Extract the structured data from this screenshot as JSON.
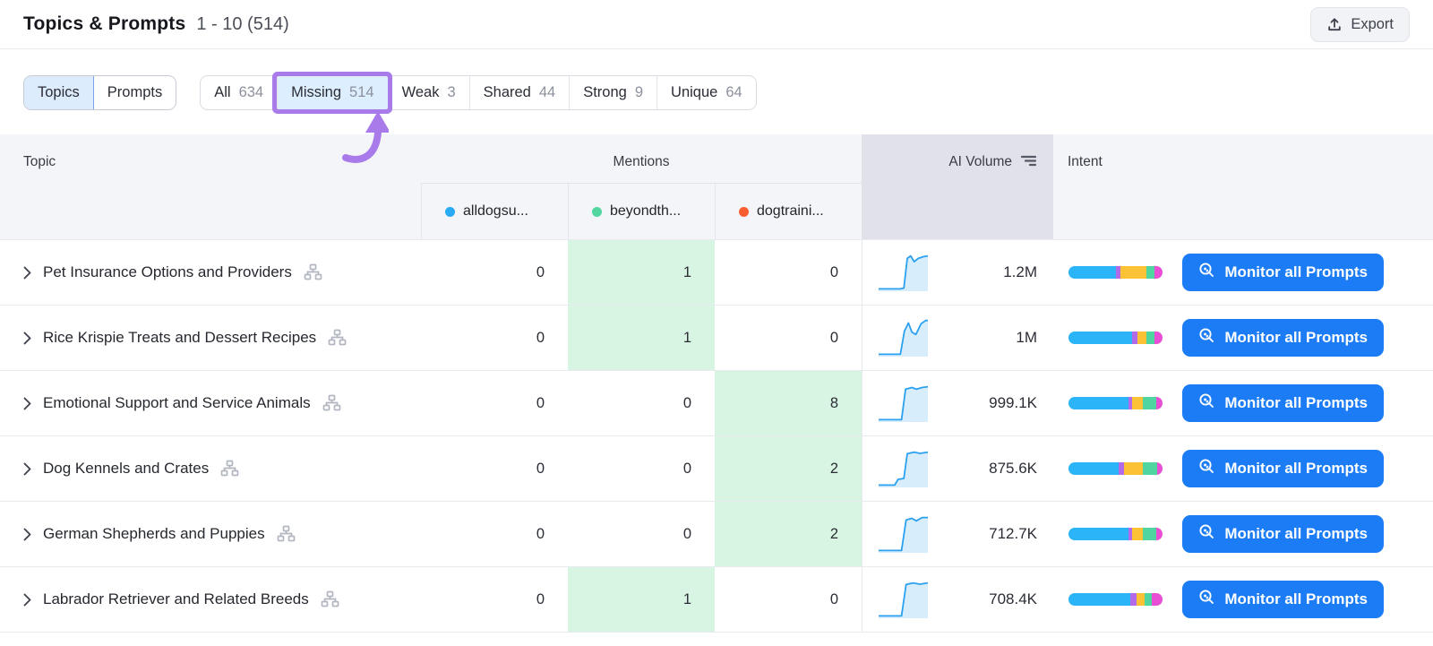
{
  "header": {
    "title": "Topics & Prompts",
    "range": "1 - 10 (514)",
    "export_label": "Export"
  },
  "toggle": [
    {
      "label": "Topics",
      "selected": true
    },
    {
      "label": "Prompts",
      "selected": false
    }
  ],
  "filters": [
    {
      "label": "All",
      "count": "634",
      "selected": false,
      "annotated": false
    },
    {
      "label": "Missing",
      "count": "514",
      "selected": true,
      "annotated": true
    },
    {
      "label": "Weak",
      "count": "3",
      "selected": false,
      "annotated": false
    },
    {
      "label": "Shared",
      "count": "44",
      "selected": false,
      "annotated": false
    },
    {
      "label": "Strong",
      "count": "9",
      "selected": false,
      "annotated": false
    },
    {
      "label": "Unique",
      "count": "64",
      "selected": false,
      "annotated": false
    }
  ],
  "table": {
    "columns": {
      "topic": "Topic",
      "mentions": "Mentions",
      "ai_volume": "AI Volume",
      "intent": "Intent"
    },
    "competitors": [
      {
        "name": "alldogsu...",
        "color": "#29aaf4"
      },
      {
        "name": "beyondth...",
        "color": "#52d6a0"
      },
      {
        "name": "dogtraini...",
        "color": "#fb5e31"
      }
    ],
    "button_label": "Monitor all Prompts",
    "rows": [
      {
        "topic": "Pet Insurance Options and Providers",
        "mentions": [
          "0",
          "1",
          "0"
        ],
        "highlight": 1,
        "ai_volume": "1.2M",
        "spark": [
          [
            0,
            90
          ],
          [
            38,
            90
          ],
          [
            44,
            88
          ],
          [
            50,
            16
          ],
          [
            56,
            10
          ],
          [
            62,
            24
          ],
          [
            69,
            16
          ],
          [
            78,
            12
          ],
          [
            86,
            10
          ]
        ],
        "intent": [
          50,
          5,
          28,
          8,
          9
        ]
      },
      {
        "topic": "Rice Krispie Treats and Dessert Recipes",
        "mentions": [
          "0",
          "1",
          "0"
        ],
        "highlight": 1,
        "ai_volume": "1M",
        "spark": [
          [
            0,
            90
          ],
          [
            38,
            90
          ],
          [
            45,
            34
          ],
          [
            52,
            14
          ],
          [
            58,
            36
          ],
          [
            65,
            42
          ],
          [
            74,
            16
          ],
          [
            82,
            8
          ],
          [
            86,
            8
          ]
        ],
        "intent": [
          68,
          5,
          10,
          8,
          9
        ]
      },
      {
        "topic": "Emotional Support and Service Animals",
        "mentions": [
          "0",
          "0",
          "8"
        ],
        "highlight": 2,
        "ai_volume": "999.1K",
        "spark": [
          [
            0,
            90
          ],
          [
            40,
            90
          ],
          [
            47,
            16
          ],
          [
            58,
            12
          ],
          [
            66,
            16
          ],
          [
            76,
            12
          ],
          [
            86,
            10
          ]
        ],
        "intent": [
          64,
          4,
          11,
          14,
          7
        ]
      },
      {
        "topic": "Dog Kennels and Crates",
        "mentions": [
          "0",
          "0",
          "2"
        ],
        "highlight": 2,
        "ai_volume": "875.6K",
        "spark": [
          [
            0,
            90
          ],
          [
            28,
            90
          ],
          [
            34,
            76
          ],
          [
            44,
            74
          ],
          [
            50,
            14
          ],
          [
            62,
            10
          ],
          [
            72,
            13
          ],
          [
            86,
            10
          ]
        ],
        "intent": [
          53,
          6,
          20,
          15,
          6
        ]
      },
      {
        "topic": "German Shepherds and Puppies",
        "mentions": [
          "0",
          "0",
          "2"
        ],
        "highlight": 2,
        "ai_volume": "712.7K",
        "spark": [
          [
            0,
            90
          ],
          [
            40,
            90
          ],
          [
            48,
            16
          ],
          [
            58,
            12
          ],
          [
            66,
            18
          ],
          [
            76,
            10
          ],
          [
            86,
            10
          ]
        ],
        "intent": [
          64,
          4,
          11,
          14,
          7
        ]
      },
      {
        "topic": "Labrador Retriever and Related Breeds",
        "mentions": [
          "0",
          "1",
          "0"
        ],
        "highlight": 1,
        "ai_volume": "708.4K",
        "spark": [
          [
            0,
            90
          ],
          [
            40,
            90
          ],
          [
            48,
            14
          ],
          [
            60,
            10
          ],
          [
            72,
            13
          ],
          [
            86,
            10
          ]
        ],
        "intent": [
          66,
          6,
          9,
          8,
          11
        ]
      }
    ]
  },
  "colors": {
    "button_blue": "#1b7cf5",
    "annotation_purple": "#a97ae9",
    "green_cell": "#d8f4e3",
    "spark_line": "#2ba1ef",
    "spark_fill": "#d7edfb",
    "intent_palette": [
      "#2bb4f7",
      "#b36ae8",
      "#fcc235",
      "#4fd6a0",
      "#e84fd4"
    ]
  }
}
